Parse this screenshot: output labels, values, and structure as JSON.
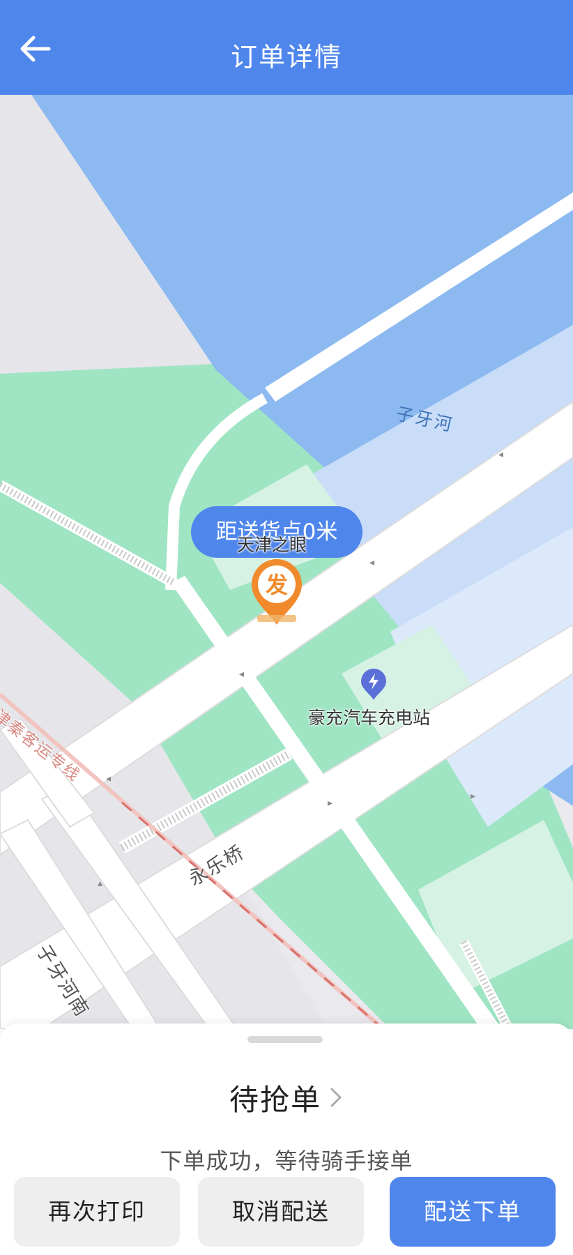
{
  "header": {
    "title": "订单详情",
    "back_icon": "arrow-left-icon",
    "color": "#4f86ec"
  },
  "map": {
    "distance_badge": "距送货点0米",
    "pin_glyph": "发",
    "pin_label": "天津之眼",
    "poi_charging": "豪充汽车充电站",
    "charging_icon": "lightning-icon",
    "river_label": "子牙河",
    "bridge_label": "永乐桥",
    "road_label": "子牙河南",
    "railway_label": "津秦客运专线",
    "colors": {
      "water": "#8cb9f0",
      "water_light": "#dbe9fb",
      "park": "#9fe5c4",
      "land": "#e9e9ee",
      "road": "#ffffff",
      "pin": "#f08a2c"
    }
  },
  "sheet": {
    "status": "待抢单",
    "status_sub": "下单成功，等待骑手接单",
    "buttons": {
      "reprint": "再次打印",
      "cancel": "取消配送",
      "dispatch": "配送下单"
    }
  }
}
